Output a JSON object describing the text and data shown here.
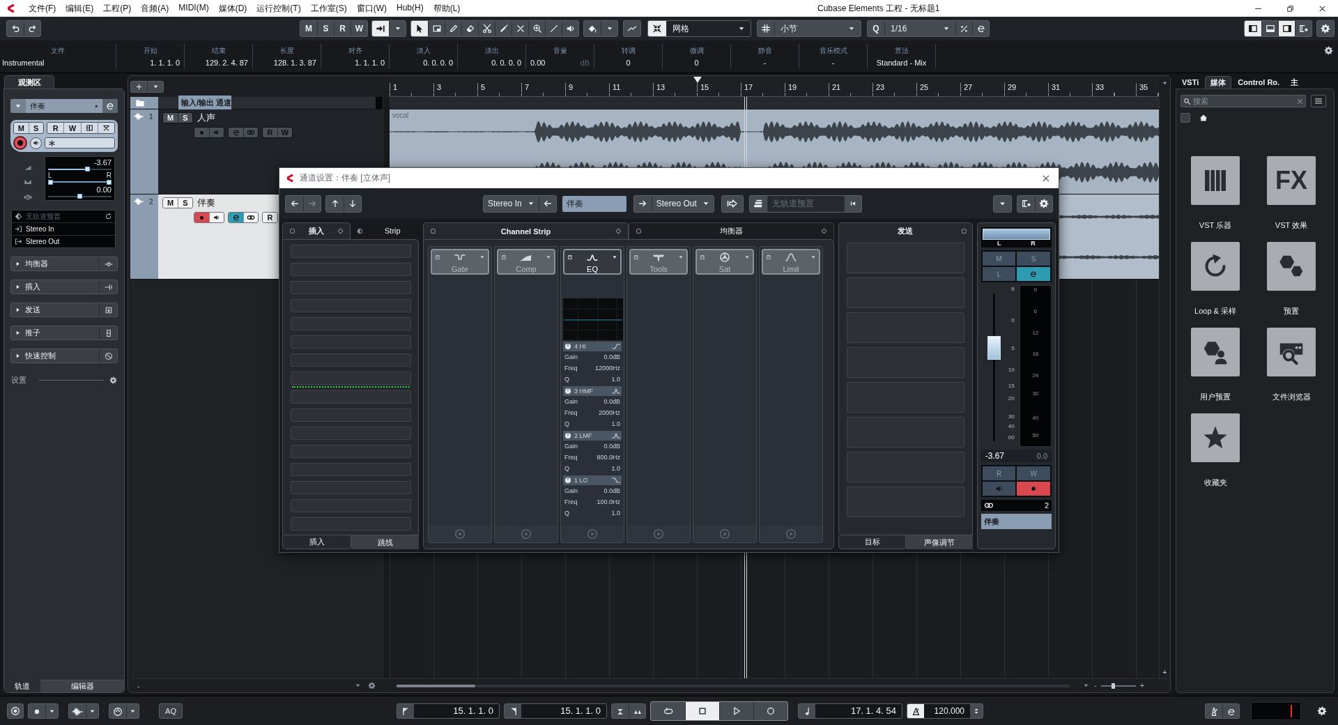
{
  "window": {
    "title": "Cubase Elements 工程 - 无标题1"
  },
  "menu": [
    "文件(F)",
    "编辑(E)",
    "工程(P)",
    "音频(A)",
    "MIDI(M)",
    "媒体(D)",
    "运行控制(T)",
    "工作室(S)",
    "窗口(W)",
    "Hub(H)",
    "帮助(L)"
  ],
  "toolbar": {
    "track_states": [
      "M",
      "S",
      "R",
      "W"
    ],
    "autoscroll": {
      "on": true
    },
    "tools": [
      {
        "kind": "pointer",
        "selected": true
      },
      {
        "kind": "range",
        "selected": false
      },
      {
        "kind": "pencil",
        "selected": false
      },
      {
        "kind": "eraser",
        "selected": false
      },
      {
        "kind": "scissors",
        "selected": false
      },
      {
        "kind": "glue",
        "selected": false
      },
      {
        "kind": "mute",
        "selected": false
      },
      {
        "kind": "zoom",
        "selected": false
      },
      {
        "kind": "line",
        "selected": false
      },
      {
        "kind": "speaker",
        "selected": false
      }
    ],
    "snap": {
      "on": true,
      "mode": "网格"
    },
    "grid": "小节",
    "quantize": {
      "symbol": "Q",
      "value": "1/16"
    },
    "zones": [
      {
        "kind": "left",
        "on": true
      },
      {
        "kind": "lower",
        "on": false
      },
      {
        "kind": "right",
        "on": true
      }
    ]
  },
  "info_line": [
    {
      "kind": "text",
      "label": "文件",
      "value": "Instrumental"
    },
    {
      "kind": "time",
      "label": "开始",
      "value": "1. 1. 1. 0"
    },
    {
      "kind": "time",
      "label": "结束",
      "value": "129. 2. 4. 87"
    },
    {
      "kind": "time",
      "label": "长度",
      "value": "128. 1. 3. 87"
    },
    {
      "kind": "time",
      "label": "对齐",
      "value": "1. 1. 1. 0"
    },
    {
      "kind": "time",
      "label": "淡入",
      "value": "0. 0. 0. 0"
    },
    {
      "kind": "time",
      "label": "淡出",
      "value": "0. 0. 0. 0"
    },
    {
      "kind": "level",
      "label": "音量",
      "value": "0.00",
      "unit": "dB"
    },
    {
      "kind": "plain",
      "label": "转调",
      "value": "0"
    },
    {
      "kind": "plain",
      "label": "微调",
      "value": "0"
    },
    {
      "kind": "plain",
      "label": "静音",
      "value": "-"
    },
    {
      "kind": "plain",
      "label": "音乐模式",
      "value": "-"
    },
    {
      "kind": "plain",
      "label": "算法",
      "value": "Standard - Mix"
    }
  ],
  "inspector": {
    "tab": "观测区",
    "track": {
      "name": "伴奏",
      "expanded": true
    },
    "state_buttons": [
      "M",
      "S",
      "R",
      "W"
    ],
    "record": true,
    "monitor": false,
    "volume": {
      "value": "-3.67",
      "level": 0.63
    },
    "pan": {
      "left": "L",
      "right": "R",
      "handles": [
        {
          "level": 0
        },
        {
          "level": 1
        }
      ]
    },
    "delay": {
      "value": "0.00",
      "level": 0.5
    },
    "routing": [
      {
        "kind": "preset",
        "label": "无轨道预置"
      },
      {
        "kind": "input",
        "label": "Stereo In"
      },
      {
        "kind": "output",
        "label": "Stereo Out"
      }
    ],
    "sections": [
      {
        "kind": "eq",
        "label": "均衡器",
        "expanded": false
      },
      {
        "kind": "insert",
        "label": "插入",
        "expanded": false
      },
      {
        "kind": "send",
        "label": "发送",
        "expanded": false
      },
      {
        "kind": "fader",
        "label": "推子",
        "expanded": false
      },
      {
        "kind": "quick",
        "label": "快速控制",
        "expanded": false
      }
    ],
    "settings_label": "设置",
    "tabs": [
      {
        "label": "轨道",
        "selected": true
      },
      {
        "label": "编辑器",
        "selected": false
      }
    ]
  },
  "project": {
    "ruler": [
      "1",
      "3",
      "5",
      "7",
      "9",
      "11",
      "13",
      "15",
      "17",
      "19",
      "21",
      "23",
      "25",
      "27",
      "29",
      "31",
      "33",
      "35"
    ],
    "folder": "输入/输出 通道",
    "tracks": [
      {
        "number": "1",
        "name": "人声",
        "selected": false,
        "states": [
          "M",
          "S"
        ],
        "record": false,
        "monitor": false,
        "edit": false,
        "automation": [
          "R",
          "W"
        ],
        "event": "vocal"
      },
      {
        "number": "2",
        "name": "伴奏",
        "selected": true,
        "states": [
          "M",
          "S"
        ],
        "record": true,
        "monitor": false,
        "edit": true,
        "automation": [
          "R"
        ]
      }
    ],
    "vertical_zoom_label": "+",
    "footer_label": "-",
    "zoom_labels": [
      "-",
      "+"
    ],
    "zoom": {
      "level": 0.35
    }
  },
  "channel_window": {
    "title": "通道设置：伴奏 [立体声]",
    "input": "Stereo In",
    "channel_name": "伴奏",
    "output": "Stereo Out",
    "preset_placeholder": "无轨道预置",
    "insert_tabs": [
      {
        "label": "插入",
        "selected": true
      },
      {
        "label": "Strip",
        "selected": false
      }
    ],
    "insert_footer_tabs": [
      {
        "label": "插入",
        "selected": true
      },
      {
        "label": "跳线",
        "selected": false
      }
    ],
    "strip_tabs": [
      {
        "label": "Channel Strip",
        "selected": true
      },
      {
        "label": "均衡器",
        "selected": false
      }
    ],
    "modules": [
      {
        "kind": "gate",
        "label": "Gate",
        "active": false
      },
      {
        "kind": "comp",
        "label": "Comp",
        "active": false
      },
      {
        "kind": "eq",
        "label": "EQ",
        "active": true
      },
      {
        "kind": "tools",
        "label": "Tools",
        "active": false
      },
      {
        "kind": "sat",
        "label": "Sat",
        "active": false
      },
      {
        "kind": "limit",
        "label": "Limit",
        "active": false
      }
    ],
    "eq_bands": [
      {
        "kind": "high_shelf",
        "name": "4 HI",
        "params": [
          {
            "label": "Gain",
            "value": "0.0dB"
          },
          {
            "label": "Freq",
            "value": "12000Hz"
          },
          {
            "label": "Q",
            "value": "1.0"
          }
        ]
      },
      {
        "kind": "peak",
        "name": "3 HMF",
        "params": [
          {
            "label": "Gain",
            "value": "0.0dB"
          },
          {
            "label": "Freq",
            "value": "2000Hz"
          },
          {
            "label": "Q",
            "value": "1.0"
          }
        ]
      },
      {
        "kind": "peak",
        "name": "2 LMF",
        "params": [
          {
            "label": "Gain",
            "value": "0.0dB"
          },
          {
            "label": "Freq",
            "value": "800.0Hz"
          },
          {
            "label": "Q",
            "value": "1.0"
          }
        ]
      },
      {
        "kind": "low_shelf",
        "name": "1 LO",
        "params": [
          {
            "label": "Gain",
            "value": "0.0dB"
          },
          {
            "label": "Freq",
            "value": "100.0Hz"
          },
          {
            "label": "Q",
            "value": "1.0"
          }
        ]
      }
    ],
    "sends": {
      "title": "发送",
      "tabs": [
        {
          "label": "目标",
          "selected": true
        },
        {
          "label": "声像调节",
          "selected": false
        }
      ]
    },
    "fader": {
      "pan_labels": [
        "L",
        "R"
      ],
      "buttons": [
        {
          "kind": "text",
          "label": "M",
          "on": false
        },
        {
          "kind": "text",
          "label": "S",
          "on": false
        },
        {
          "kind": "text",
          "label": "L",
          "on": false
        },
        {
          "kind": "edit",
          "on": true
        }
      ],
      "scale": [
        "6",
        "0",
        "5",
        "10",
        "15",
        "20",
        "30",
        "40",
        "00"
      ],
      "meter_scale": [
        "0",
        "6",
        "12",
        "18",
        "24",
        "30",
        "40",
        "50"
      ],
      "level": 0.63,
      "volume": "-3.67",
      "pan": "0.0",
      "automation": [
        {
          "kind": "text",
          "label": "R",
          "on": false
        },
        {
          "kind": "text",
          "label": "W",
          "on": false
        },
        {
          "kind": "monitor",
          "on": false
        },
        {
          "kind": "record",
          "on": true
        }
      ],
      "number": "2",
      "name": "伴奏"
    }
  },
  "media_panel": {
    "tabs": [
      {
        "label": "VSTi",
        "selected": false
      },
      {
        "label": "媒体",
        "selected": true
      },
      {
        "label": "Control Ro.",
        "selected": false
      },
      {
        "label": "主",
        "selected": false
      }
    ],
    "search_placeholder": "搜索",
    "filter_checked": false,
    "fx_tile_text": "FX",
    "tiles": [
      {
        "kind": "instruments",
        "label": "VST 乐器"
      },
      {
        "kind": "effects",
        "label": "VST 效果"
      },
      {
        "kind": "loops",
        "label": "Loop & 采样"
      },
      {
        "kind": "presets",
        "label": "预置"
      },
      {
        "kind": "user_presets",
        "label": "用户预置"
      },
      {
        "kind": "file_browser",
        "label": "文件浏览器"
      },
      {
        "kind": "favorites",
        "label": "收藏夹"
      }
    ]
  },
  "transport": {
    "aq": "AQ",
    "left_locator": "15. 1. 1. 0",
    "right_locator": "15. 1. 1. 0",
    "controls": [
      {
        "kind": "cycle",
        "selected": false
      },
      {
        "kind": "stop",
        "selected": true
      },
      {
        "kind": "play",
        "selected": false
      },
      {
        "kind": "record",
        "selected": false
      }
    ],
    "position": "17. 1. 4. 54",
    "tempo": "120.000"
  }
}
